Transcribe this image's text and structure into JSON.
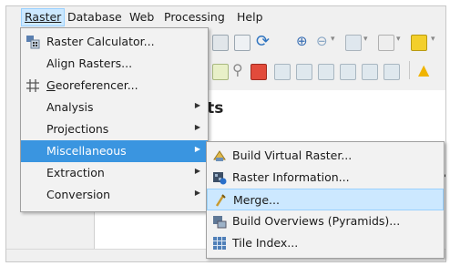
{
  "menubar": {
    "items": [
      {
        "label": "Raster"
      },
      {
        "label": "Database"
      },
      {
        "label": "Web"
      },
      {
        "label": "Processing"
      },
      {
        "label": "Help"
      }
    ]
  },
  "background": {
    "panel_title": "cts"
  },
  "raster_menu": {
    "items": [
      {
        "label": "Raster Calculator...",
        "icon": "raster-calculator-icon"
      },
      {
        "label": "Align Rasters..."
      },
      {
        "label": "Georeferencer...",
        "icon": "georeferencer-icon"
      },
      {
        "label": "Analysis",
        "submenu": true
      },
      {
        "label": "Projections",
        "submenu": true
      },
      {
        "label": "Miscellaneous",
        "submenu": true,
        "highlighted": true
      },
      {
        "label": "Extraction",
        "submenu": true
      },
      {
        "label": "Conversion",
        "submenu": true
      }
    ]
  },
  "misc_submenu": {
    "items": [
      {
        "label": "Build Virtual Raster...",
        "icon": "virtual-raster-icon"
      },
      {
        "label": "Raster Information...",
        "icon": "raster-information-icon"
      },
      {
        "label": "Merge...",
        "icon": "merge-icon",
        "hovered": true
      },
      {
        "label": "Build Overviews (Pyramids)...",
        "icon": "overviews-icon"
      },
      {
        "label": "Tile Index...",
        "icon": "tile-index-icon"
      }
    ]
  },
  "colors": {
    "highlight": "#3a95e0",
    "hover": "#cce8ff"
  }
}
